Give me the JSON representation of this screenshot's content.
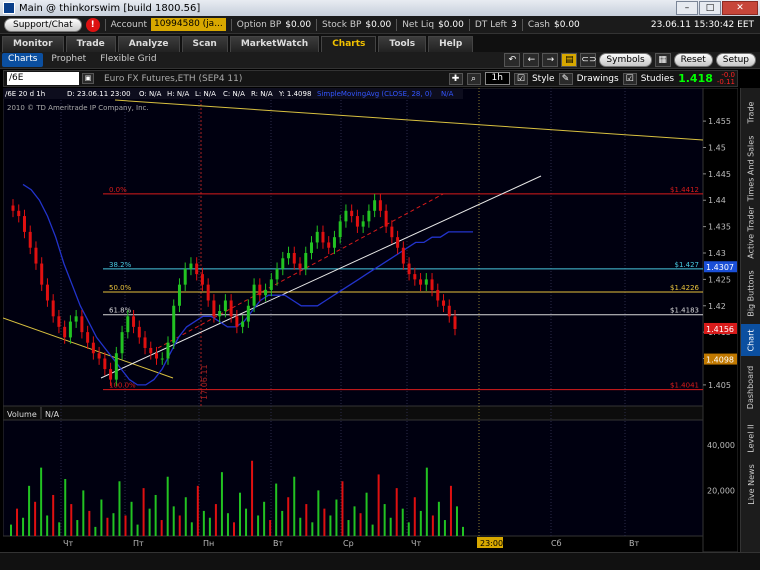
{
  "window": {
    "title": "Main @ thinkorswim [build 1800.56]",
    "minimize": "–",
    "maximize": "□",
    "close": "✕"
  },
  "account_bar": {
    "support_label": "Support/Chat",
    "alert_label": "!",
    "account_label": "Account",
    "account_value": "10994580 (ja...",
    "option_bp_label": "Option BP",
    "option_bp_value": "$0.00",
    "stock_bp_label": "Stock BP",
    "stock_bp_value": "$0.00",
    "net_liq_label": "Net Liq",
    "net_liq_value": "$0.00",
    "dt_left_label": "DT Left",
    "dt_left_value": "3",
    "cash_label": "Cash",
    "cash_value": "$0.00",
    "clock": "23.06.11 15:30:42 EET"
  },
  "tabs": [
    "Monitor",
    "Trade",
    "Analyze",
    "Scan",
    "MarketWatch",
    "Charts",
    "Tools",
    "Help"
  ],
  "active_tab": "Charts",
  "subtabs": [
    "Charts",
    "Prophet",
    "Flexible Grid"
  ],
  "toolbar": {
    "symbols": "Symbols",
    "reset": "Reset",
    "setup": "Setup"
  },
  "chart_header": {
    "symbol": "/6E",
    "description": "Euro FX Futures,ETH (SEP4 11)",
    "timeframe": "1h",
    "style": "Style",
    "drawings": "Drawings",
    "studies": "Studies",
    "last": "1.418",
    "change_line1": "-0.0",
    "change_line2": "-0.11"
  },
  "chart_info": {
    "symbol_line": "/6E 20 d 1h",
    "d_label": "D: 23.06.11 23:00",
    "o": "O: N/A",
    "h": "H: N/A",
    "l": "L: N/A",
    "c": "C: N/A",
    "r": "R: N/A",
    "y": "Y: 1.4098",
    "study": "SimpleMovingAvg (CLOSE, 28, 0)",
    "study_na": "N/A",
    "copyright": "2010 © TD Ameritrade IP Company, Inc."
  },
  "chart_data": {
    "type": "candlestick",
    "symbol": "/6E",
    "ylim": [
      1.401,
      1.459
    ],
    "y_ticks": [
      "1.455",
      "1.45",
      "1.445",
      "1.44",
      "1.435",
      "1.43",
      "1.425",
      "1.42",
      "1.415",
      "1.41",
      "1.405"
    ],
    "x_labels": [
      "Чт",
      "Пт",
      "Пн",
      "Вт",
      "Ср",
      "Чт",
      "23:00",
      "Сб",
      "Вт"
    ],
    "close_series": [
      1.438,
      1.437,
      1.434,
      1.431,
      1.428,
      1.424,
      1.421,
      1.418,
      1.416,
      1.414,
      1.417,
      1.418,
      1.415,
      1.413,
      1.411,
      1.41,
      1.408,
      1.406,
      1.411,
      1.415,
      1.418,
      1.416,
      1.414,
      1.412,
      1.411,
      1.41,
      1.41,
      1.413,
      1.42,
      1.424,
      1.427,
      1.428,
      1.426,
      1.424,
      1.421,
      1.418,
      1.419,
      1.421,
      1.418,
      1.416,
      1.417,
      1.42,
      1.424,
      1.422,
      1.423,
      1.425,
      1.427,
      1.429,
      1.43,
      1.428,
      1.427,
      1.43,
      1.432,
      1.434,
      1.432,
      1.431,
      1.433,
      1.436,
      1.438,
      1.437,
      1.435,
      1.436,
      1.438,
      1.44,
      1.438,
      1.435,
      1.433,
      1.431,
      1.428,
      1.426,
      1.425,
      1.424,
      1.425,
      1.423,
      1.421,
      1.42,
      1.418,
      1.4156
    ],
    "moving_average": [
      1.443,
      1.442,
      1.44,
      1.437,
      1.433,
      1.428,
      1.424,
      1.42,
      1.417,
      1.414,
      1.412,
      1.41,
      1.408,
      1.406,
      1.405,
      1.405,
      1.406,
      1.408,
      1.411,
      1.414,
      1.416,
      1.417,
      1.418,
      1.418,
      1.417,
      1.416,
      1.416,
      1.417,
      1.419,
      1.421,
      1.422,
      1.422,
      1.422,
      1.421,
      1.42,
      1.42,
      1.42,
      1.421,
      1.422,
      1.423,
      1.424,
      1.425,
      1.426,
      1.427,
      1.428,
      1.429,
      1.43,
      1.431,
      1.432,
      1.432,
      1.433,
      1.433,
      1.434,
      1.434,
      1.434,
      1.434
    ],
    "volume": [
      5000,
      12000,
      8000,
      22000,
      15000,
      30000,
      9000,
      18000,
      6000,
      25000,
      14000,
      7000,
      20000,
      11000,
      4000,
      16000,
      8000,
      10000,
      24000,
      9000,
      15000,
      5000,
      21000,
      12000,
      18000,
      7000,
      26000,
      13000,
      9000,
      17000,
      6000,
      22000,
      11000,
      8000,
      14000,
      28000,
      10000,
      6000,
      19000,
      12000,
      33000,
      9000,
      15000,
      7000,
      23000,
      11000,
      17000,
      26000,
      8000,
      14000,
      6000,
      20000,
      12000,
      9000,
      16000,
      24000,
      7000,
      13000,
      10000,
      19000,
      5000,
      27000,
      14000,
      8000,
      21000,
      12000,
      6000,
      17000,
      11000,
      30000,
      9000,
      15000,
      7000,
      22000,
      13000,
      4000
    ],
    "volume_ylim": [
      0,
      50000
    ],
    "volume_ticks": [
      "40,000",
      "20,000"
    ],
    "volume_label": "Volume",
    "volume_na": "N/A",
    "fib_levels": [
      {
        "pct": "0.0%",
        "price": 1.4412,
        "label": "$1.4412",
        "color": "#d81b1b"
      },
      {
        "pct": "38.2%",
        "price": 1.427,
        "label": "$1.427",
        "color": "#48c8e0"
      },
      {
        "pct": "50.0%",
        "price": 1.4226,
        "label": "$1.4226",
        "color": "#e8c23c"
      },
      {
        "pct": "61.8%",
        "price": 1.4183,
        "label": "$1.4183",
        "color": "#d8d8d8"
      },
      {
        "pct": "100.0%",
        "price": 1.4041,
        "label": "$1.4041",
        "color": "#d81b1b"
      }
    ],
    "price_tags": [
      {
        "text": "1.4307",
        "price": 1.4273,
        "bg": "#1a4fd6"
      },
      {
        "text": "1.4156",
        "price": 1.4156,
        "bg": "#d81b1b"
      },
      {
        "text": "1.4098",
        "price": 1.4098,
        "bg": "#c07800"
      }
    ],
    "date_marker": "17.06.11",
    "time_tag": "23:00"
  },
  "sidebar": [
    "Trade",
    "Times And Sales",
    "Active Trader",
    "Big Buttons",
    "Chart",
    "Dashboard",
    "Level II",
    "Live News"
  ],
  "sidebar_active": "Chart",
  "colors": {
    "accent": "#f0c000",
    "bull": "#22c322",
    "bear": "#e01010",
    "ma": "#2233cc"
  }
}
